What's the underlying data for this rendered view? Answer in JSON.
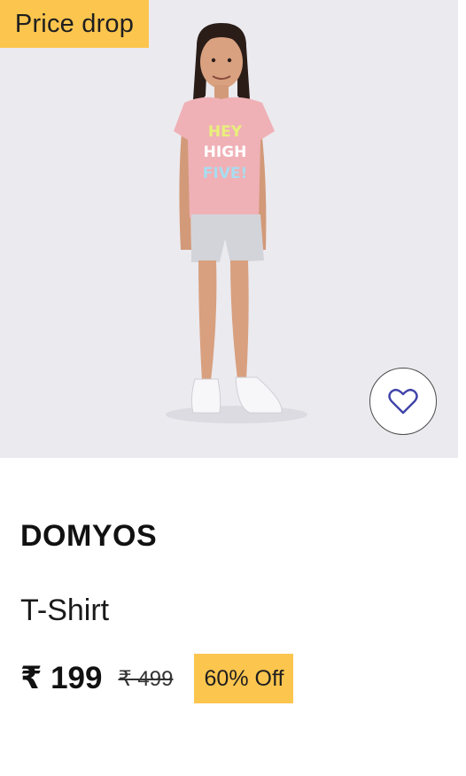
{
  "product": {
    "badge": "Price drop",
    "brand": "DOMYOS",
    "name": "T-Shirt",
    "price": "₹ 199",
    "original_price": "₹ 499",
    "discount": "60% Off",
    "shirt_print": [
      "HEY",
      "HIGH",
      "FIVE!"
    ]
  },
  "colors": {
    "badge_yellow": "#fcc54e",
    "image_background": "#ebeaef",
    "heart_outline": "#3f43a8"
  },
  "icons": {
    "wishlist": "heart-outline-icon"
  }
}
